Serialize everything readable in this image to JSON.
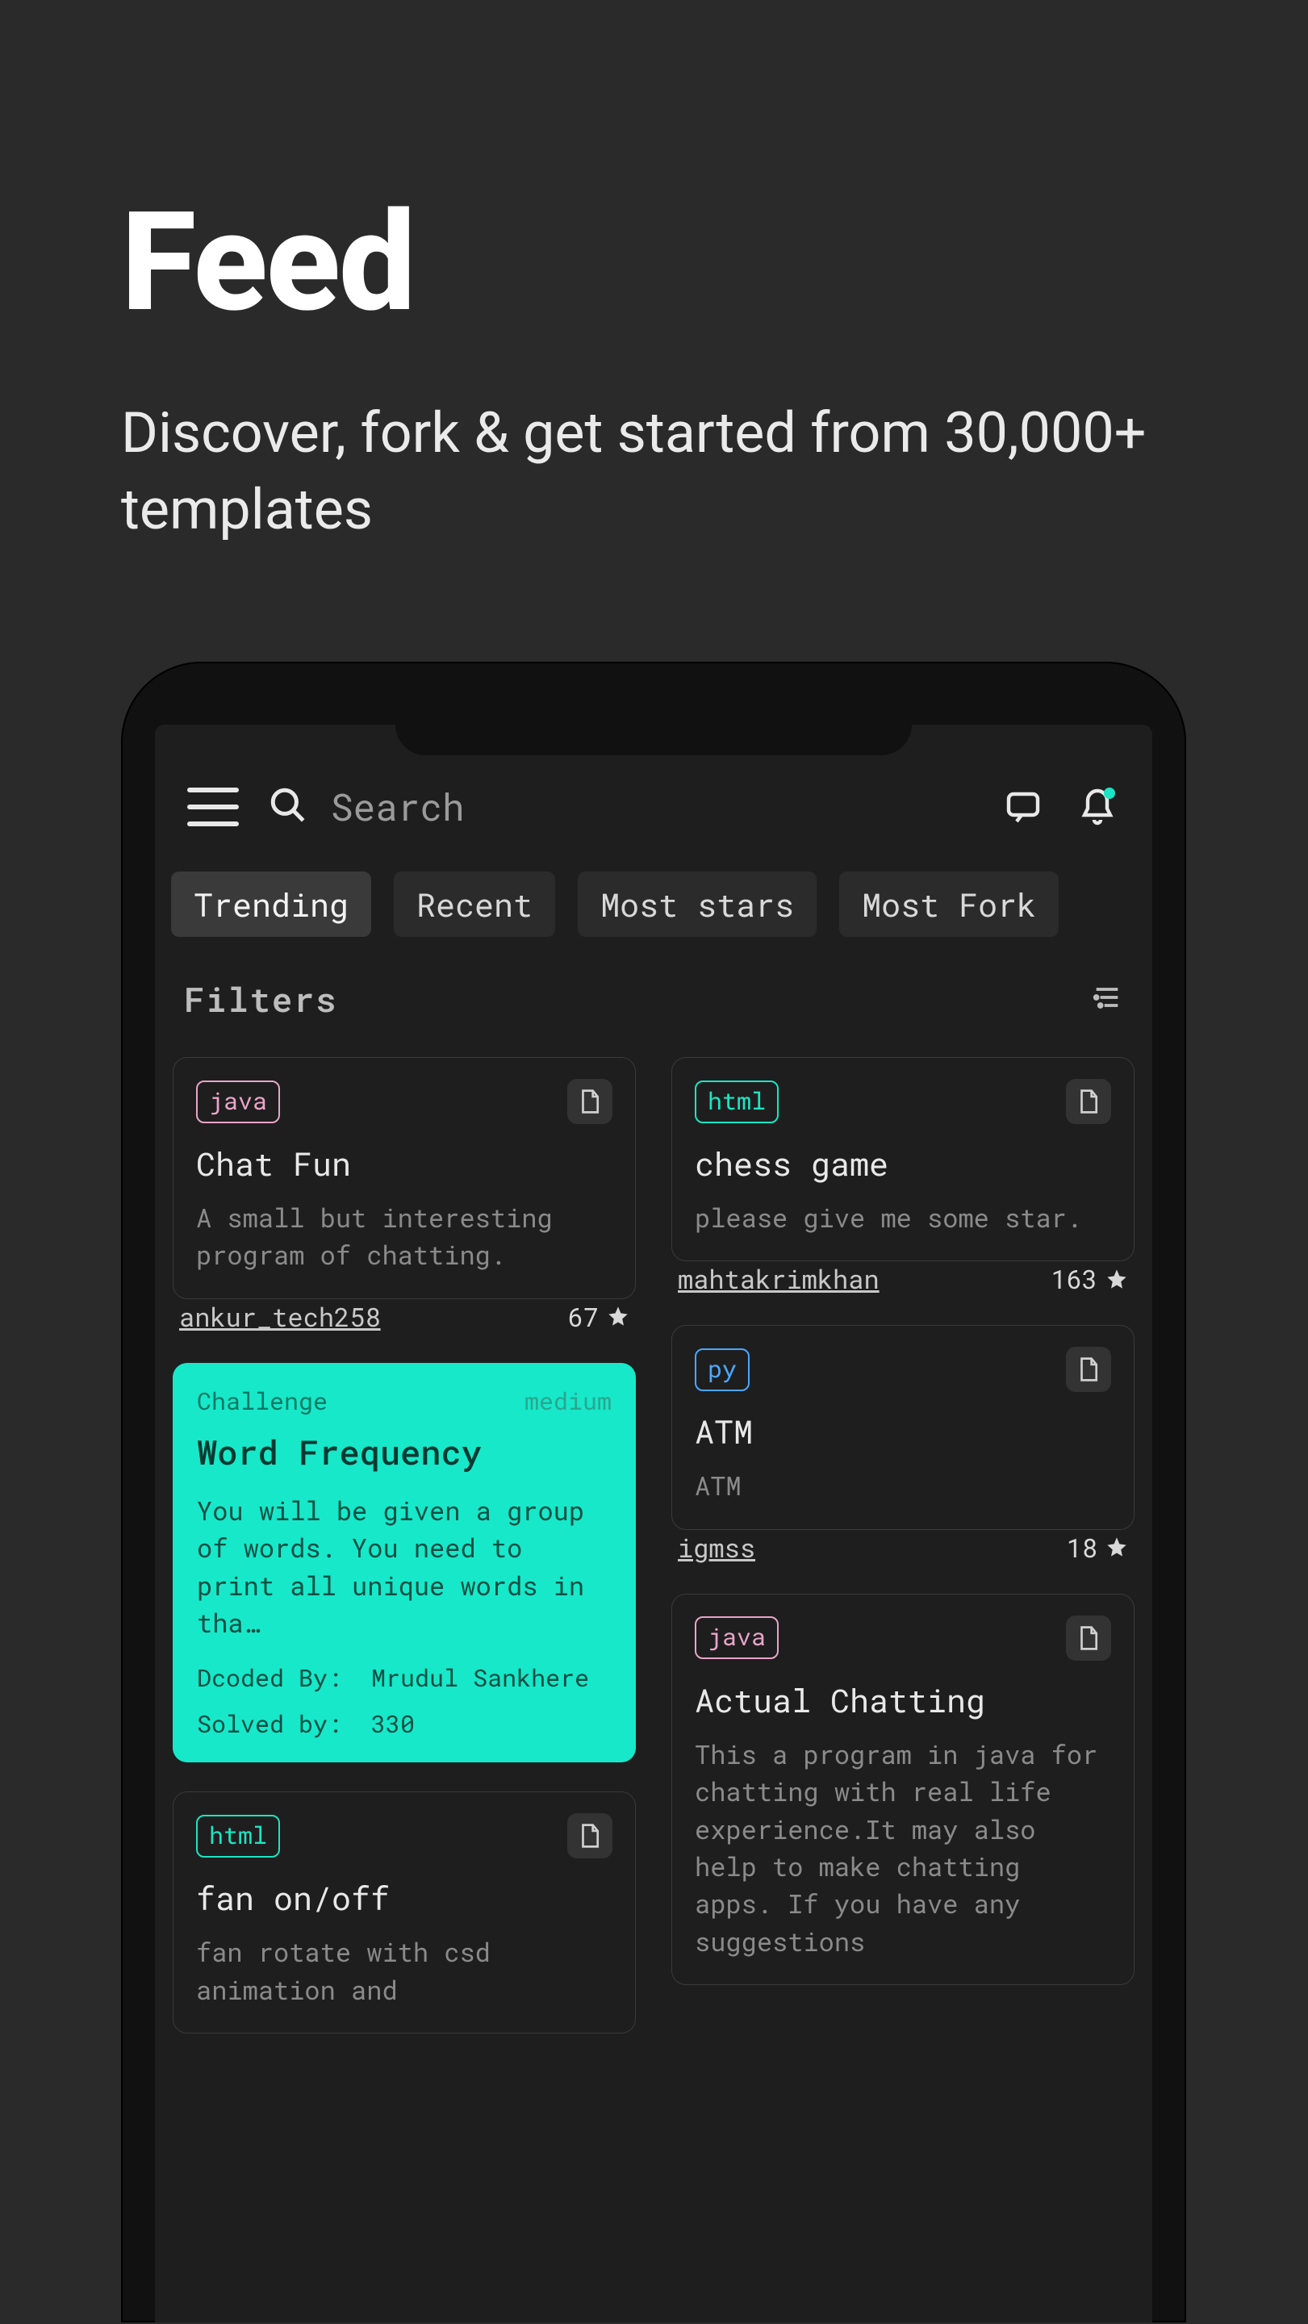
{
  "hero": {
    "title": "Feed",
    "subtitle": "Discover, fork & get started from 30,000+ templates"
  },
  "search": {
    "placeholder": "Search"
  },
  "tabs": [
    "Trending",
    "Recent",
    "Most stars",
    "Most Fork"
  ],
  "filters_label": "Filters",
  "left_col": [
    {
      "kind": "project",
      "lang": "java",
      "title": "Chat Fun",
      "desc": "A small but interesting program of chatting.",
      "author": "ankur_tech258",
      "stars": "67"
    },
    {
      "kind": "challenge",
      "tag": "Challenge",
      "difficulty": "medium",
      "title": "Word Frequency",
      "desc": "You will be given a group of words. You need to print all unique words in tha…",
      "dcoded_label": "Dcoded By:",
      "dcoded_by": "Mrudul Sankhere",
      "solved_label": "Solved by:",
      "solved_by": "330"
    },
    {
      "kind": "project",
      "lang": "html",
      "title": "fan on/off",
      "desc": "fan rotate with csd animation and"
    }
  ],
  "right_col": [
    {
      "kind": "project",
      "lang": "html",
      "title": "chess game",
      "desc": "please give me some star.",
      "author": "mahtakrimkhan",
      "stars": "163"
    },
    {
      "kind": "project",
      "lang": "py",
      "title": "ATM",
      "desc": "ATM",
      "author": "igmss",
      "stars": "18"
    },
    {
      "kind": "project",
      "lang": "java",
      "title": "Actual Chatting",
      "desc": "This a program in java for chatting with real life experience.It may also help to make chatting apps. If you have any suggestions"
    }
  ]
}
